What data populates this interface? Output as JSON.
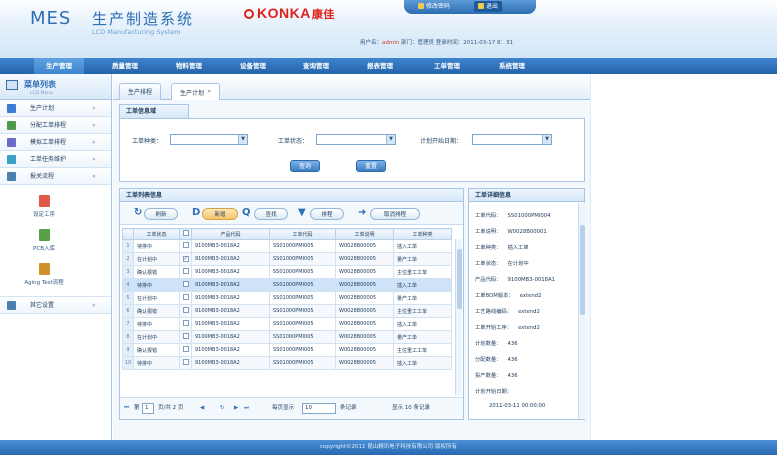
{
  "header": {
    "logo_mes": "MES",
    "logo_cn": "生产制造系统",
    "logo_en": "LCD Manufacturing System",
    "brand": "KONKA",
    "brand_cn": "康佳",
    "change_password": "修改密码",
    "exit": "退出",
    "user_prefix": "用户名：",
    "user_name": "admin",
    "user_suffix": " 部门：管理员  登录时间：2011-03-17  8：31"
  },
  "topnav": [
    "生产管理",
    "质量管理",
    "物料管理",
    "设备管理",
    "查询管理",
    "报表管理",
    "工单管理",
    "系统管理"
  ],
  "sidebar": {
    "title": "菜单列表",
    "subtitle": "LCD Manu",
    "items": [
      {
        "label": "生产计划",
        "color": "#3a7bd5"
      },
      {
        "label": "分配工单排程",
        "color": "#4d9a4d"
      },
      {
        "label": "模拟工单排程",
        "color": "#6c6cc8"
      },
      {
        "label": "工单任务维护",
        "color": "#3ba0c8"
      },
      {
        "label": "报关流程",
        "color": "#4a7fb0"
      }
    ],
    "sub_items": [
      {
        "label": "设定工序",
        "color": "#e05a4a"
      },
      {
        "label": "PCB入库",
        "color": "#5aa04c"
      },
      {
        "label": "Aging Test流程",
        "color": "#d0902a"
      }
    ],
    "bottom_item": {
      "label": "其它设置",
      "color": "#4a7fb0"
    }
  },
  "tabs": [
    {
      "label": "生产排程",
      "active": false
    },
    {
      "label": "生产计划",
      "active": true
    }
  ],
  "query": {
    "title": "工单信息域",
    "fields": [
      {
        "label": "工单种类：",
        "value": ""
      },
      {
        "label": "工单状态：",
        "value": ""
      },
      {
        "label": "计划开始日期：",
        "value": ""
      }
    ],
    "search_btn": "查询",
    "reset_btn": "重置"
  },
  "list": {
    "title": "工单列表信息",
    "toolbar": [
      "刷新",
      "新增",
      "查找",
      "排程",
      "取消排程"
    ],
    "columns": [
      "工单状态",
      "",
      "产品代码",
      "工单代码",
      "工单说明",
      "工单种类"
    ],
    "rows": [
      {
        "no": "1",
        "checked": false,
        "status": "待排中",
        "product": "9100MB3-0018A2",
        "code": "SS01000PMI005",
        "desc": "W0028B00005",
        "kind": "插入工单"
      },
      {
        "no": "2",
        "checked": true,
        "status": "在计划中",
        "product": "9100MB3-0018A2",
        "code": "SS01000PMI005",
        "desc": "W0028B00005",
        "kind": "量产工单"
      },
      {
        "no": "3",
        "checked": false,
        "status": "确认报错",
        "product": "9100MB3-0018A2",
        "code": "SS01000PMI005",
        "desc": "W0028B00005",
        "kind": "主位重工工单"
      },
      {
        "no": "4",
        "checked": false,
        "status": "待排中",
        "product": "9100MB3-0018A2",
        "code": "SS01000PMI005",
        "desc": "W0028B00005",
        "kind": "插入工单"
      },
      {
        "no": "5",
        "checked": false,
        "status": "在计划中",
        "product": "9100MB3-0018A2",
        "code": "SS01000PMI005",
        "desc": "W0028B00005",
        "kind": "量产工单"
      },
      {
        "no": "6",
        "checked": false,
        "status": "确认报错",
        "product": "9100MB3-0018A2",
        "code": "SS01000PMI005",
        "desc": "W0028B00005",
        "kind": "主位重工工单"
      },
      {
        "no": "7",
        "checked": false,
        "status": "待排中",
        "product": "9100MB3-0018A2",
        "code": "SS01000PMI005",
        "desc": "W0028B00005",
        "kind": "插入工单"
      },
      {
        "no": "8",
        "checked": false,
        "status": "在计划中",
        "product": "9100MB3-0018A2",
        "code": "SS01000PMI005",
        "desc": "W0028B00005",
        "kind": "量产工单"
      },
      {
        "no": "9",
        "checked": false,
        "status": "确认报错",
        "product": "9100MB3-0018A2",
        "code": "SS01000PMI005",
        "desc": "W0028B00005",
        "kind": "主位重工工单"
      },
      {
        "no": "10",
        "checked": false,
        "status": "待排中",
        "product": "9100MB3-0018A2",
        "code": "SS01000PMI005",
        "desc": "W0028B00005",
        "kind": "插入工单"
      }
    ],
    "pager": {
      "page_label": "第",
      "page_value": "1",
      "page_total": "页/共 2 页",
      "per_page_label": "每页显示",
      "per_page_value": "10",
      "per_page_unit": "条记录",
      "summary": "显示 10 条记录"
    }
  },
  "detail": {
    "title": "工单详细信息",
    "rows": [
      {
        "label": "工单代码：",
        "value": "SS01000PMI004"
      },
      {
        "label": "工单说明：",
        "value": "W0028B00001"
      },
      {
        "label": "工单种类：",
        "value": "插入工单"
      },
      {
        "label": "工单状态：",
        "value": "在计划中"
      },
      {
        "label": "产品代码：",
        "value": "9100MB3-0018A1"
      },
      {
        "label": "工单BOM版本：",
        "value": "extend2"
      },
      {
        "label": "工艺路线编码：",
        "value": "extend2"
      },
      {
        "label": "工单开始工序：",
        "value": "extend2"
      },
      {
        "label": "计划数量：",
        "value": "436"
      },
      {
        "label": "分配数量：",
        "value": "436"
      },
      {
        "label": "投产数量：",
        "value": "436"
      },
      {
        "label": "计划开始日期：",
        "value": ""
      },
      {
        "label": "",
        "value": "2011-03-11 00:00:00"
      }
    ]
  },
  "footer": "copyright©2011  昆山精讯电子科技有限公司  版权所有"
}
